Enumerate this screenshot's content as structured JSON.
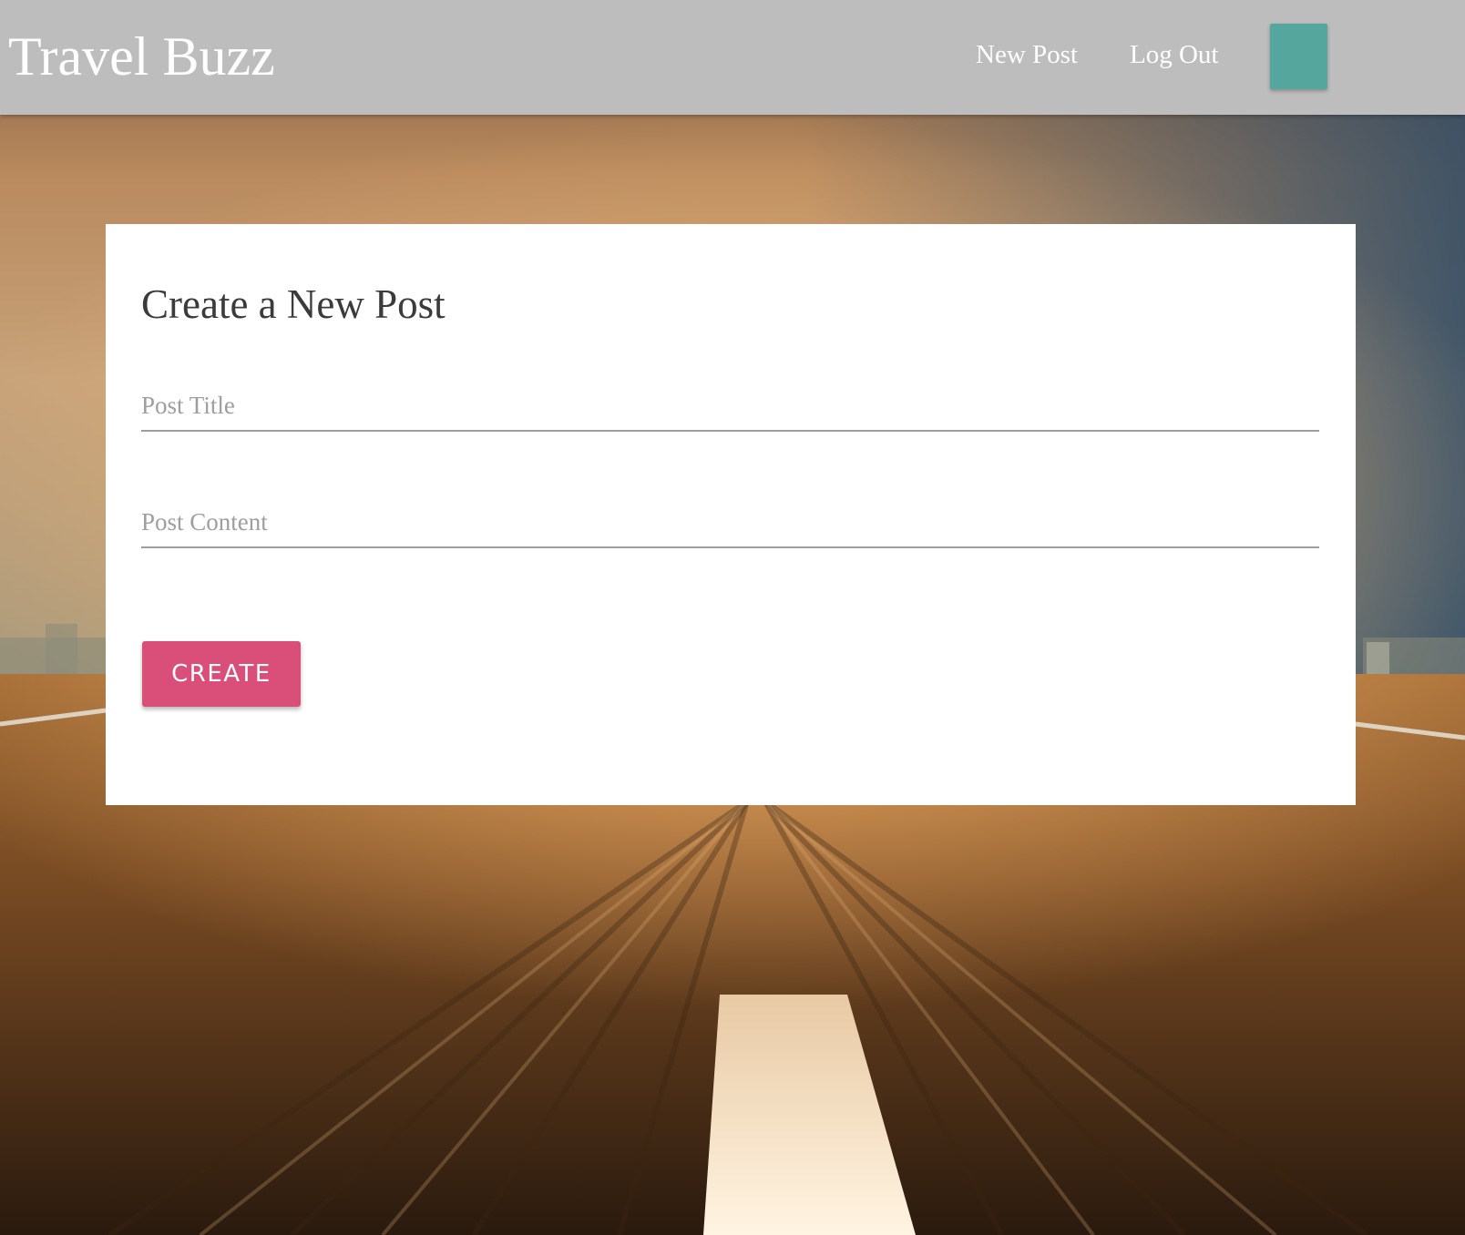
{
  "header": {
    "brand": "Travel Buzz",
    "nav": {
      "new_post_label": "New Post",
      "log_out_label": "Log Out"
    },
    "accent_button_color": "#55a79e"
  },
  "form": {
    "title": "Create a New Post",
    "post_title_placeholder": "Post Title",
    "post_title_value": "",
    "post_content_placeholder": "Post Content",
    "post_content_value": "",
    "create_label": "CREATE",
    "create_color": "#da4f7a"
  },
  "colors": {
    "navbar_bg": "#bdbdbd",
    "card_bg": "#ffffff",
    "text_dark": "#3b3b3b",
    "placeholder": "#9e9e9e"
  }
}
